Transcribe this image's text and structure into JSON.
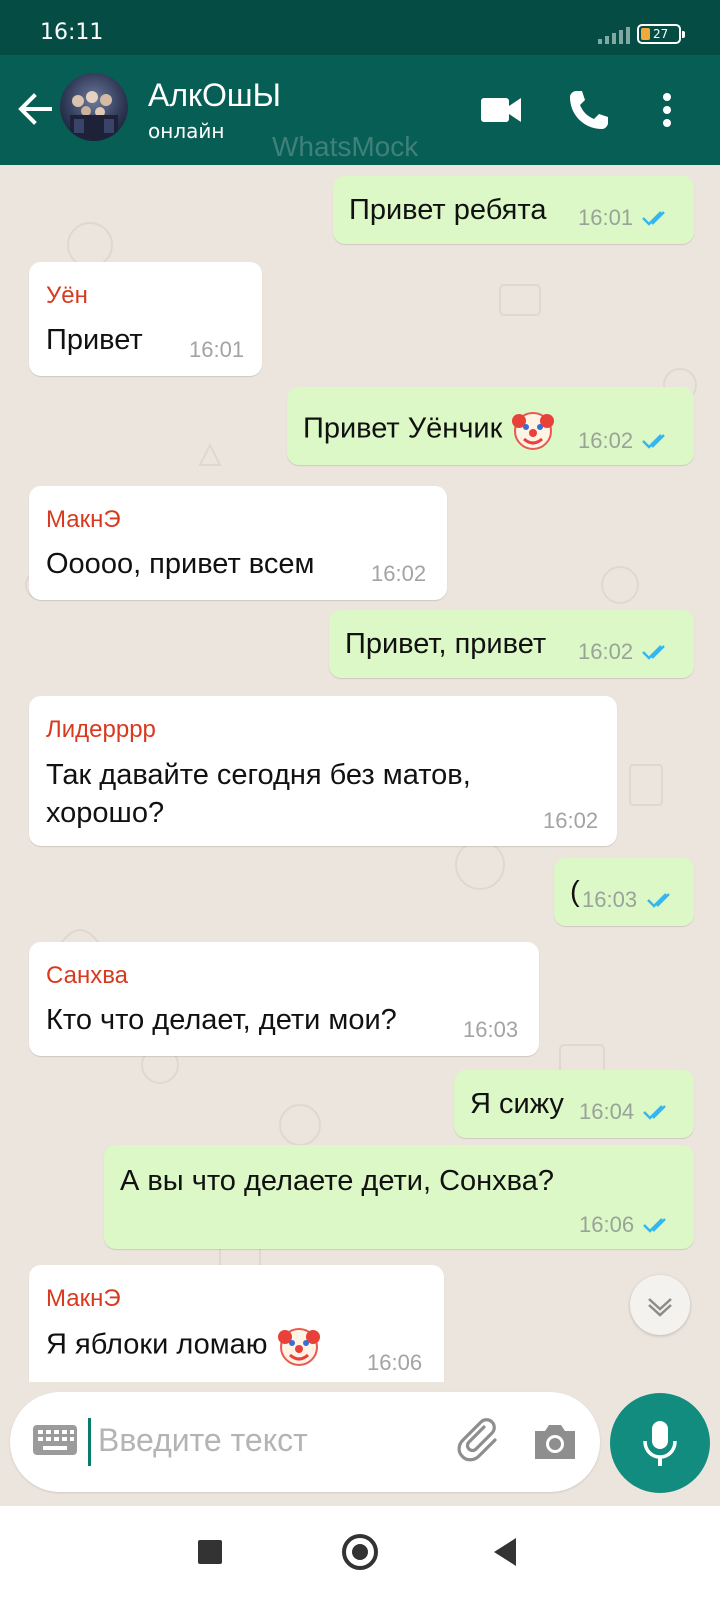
{
  "status_bar": {
    "time": "16:11",
    "battery": "27"
  },
  "header": {
    "title": "АлкОшЫ",
    "status": "онлайн",
    "watermark": "WhatsMock"
  },
  "messages": [
    {
      "direction": "out",
      "text": "Привет ребята",
      "time": "16:01",
      "read": true
    },
    {
      "direction": "in",
      "sender": "Уён",
      "text": "Привет",
      "time": "16:01"
    },
    {
      "direction": "out",
      "text": "Привет Уёнчик",
      "emoji": "clown-face",
      "time": "16:02",
      "read": true
    },
    {
      "direction": "in",
      "sender": "МакнЭ",
      "text": "Ооооо, привет всем",
      "time": "16:02"
    },
    {
      "direction": "out",
      "text": "Привет, привет",
      "time": "16:02",
      "read": true
    },
    {
      "direction": "in",
      "sender": "Лидерррр",
      "text": "Так давайте сегодня без матов, хорошо?",
      "time": "16:02"
    },
    {
      "direction": "out",
      "text": "(",
      "time": "16:03",
      "read": true
    },
    {
      "direction": "in",
      "sender": "Санхва",
      "text": "Кто что делает, дети мои?",
      "time": "16:03"
    },
    {
      "direction": "out",
      "text": "Я сижу",
      "time": "16:04",
      "read": true
    },
    {
      "direction": "out",
      "text": "А вы что делаете дети, Сонхва?",
      "time": "16:06",
      "read": true
    },
    {
      "direction": "in",
      "sender": "МакнЭ",
      "text": "Я яблоки ломаю",
      "emoji": "clown-face",
      "time": "16:06"
    }
  ],
  "input": {
    "placeholder": "Введите текст"
  },
  "colors": {
    "header": "#075e54",
    "status_bar": "#054d44",
    "outgoing_bubble": "#dcf8c6",
    "incoming_bubble": "#ffffff",
    "sender_name": "#d83a1f",
    "read_ticks": "#34b7f1",
    "mic_button": "#128c7e"
  }
}
